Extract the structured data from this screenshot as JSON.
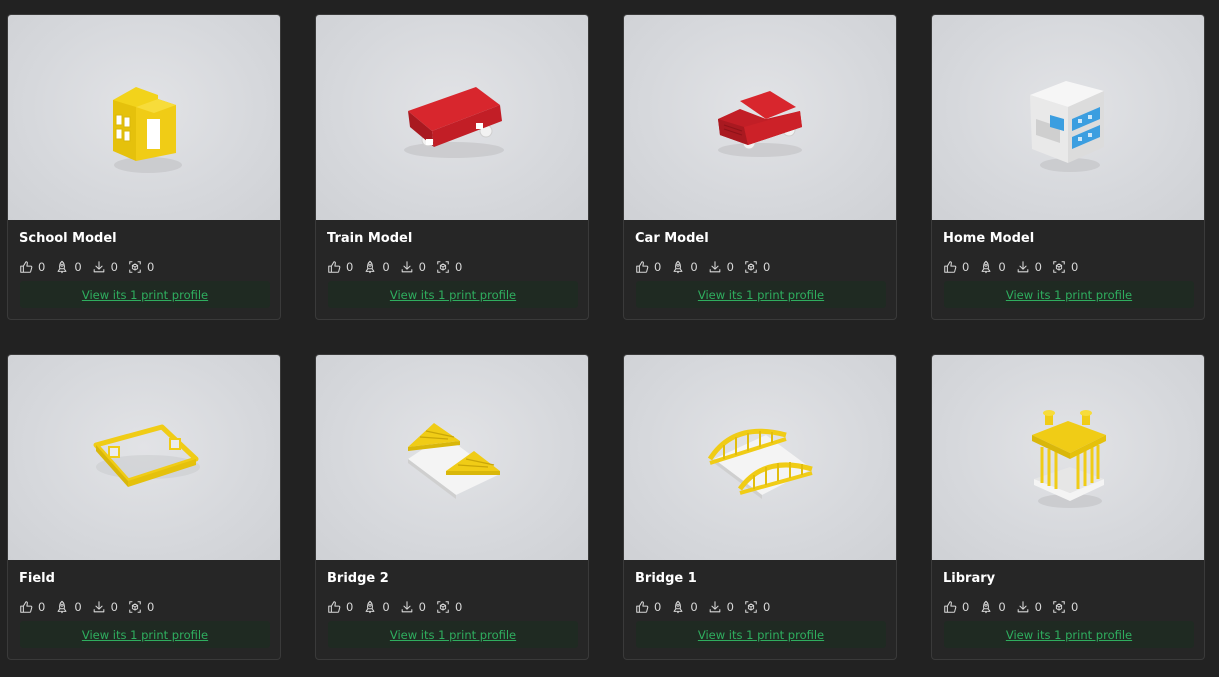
{
  "colors": {
    "page_background": "#222222",
    "card_background": "#262626",
    "link_green": "#2fae5f",
    "button_background": "#1f2a22"
  },
  "stat_icons": [
    "thumbs-up-icon",
    "rocket-icon",
    "download-icon",
    "print-icon"
  ],
  "models": [
    {
      "title": "School Model",
      "likes": "0",
      "boosts": "0",
      "downloads": "0",
      "prints": "0",
      "profile_link": "View its 1 print profile",
      "image": "yellow-school-building"
    },
    {
      "title": "Train Model",
      "likes": "0",
      "boosts": "0",
      "downloads": "0",
      "prints": "0",
      "profile_link": "View its 1 print profile",
      "image": "red-train"
    },
    {
      "title": "Car Model",
      "likes": "0",
      "boosts": "0",
      "downloads": "0",
      "prints": "0",
      "profile_link": "View its 1 print profile",
      "image": "red-car"
    },
    {
      "title": "Home Model",
      "likes": "0",
      "boosts": "0",
      "downloads": "0",
      "prints": "0",
      "profile_link": "View its 1 print profile",
      "image": "white-blue-house"
    },
    {
      "title": "Field",
      "likes": "0",
      "boosts": "0",
      "downloads": "0",
      "prints": "0",
      "profile_link": "View its 1 print profile",
      "image": "yellow-field"
    },
    {
      "title": "Bridge 2",
      "likes": "0",
      "boosts": "0",
      "downloads": "0",
      "prints": "0",
      "profile_link": "View its 1 print profile",
      "image": "yellow-triangle-bridge"
    },
    {
      "title": "Bridge 1",
      "likes": "0",
      "boosts": "0",
      "downloads": "0",
      "prints": "0",
      "profile_link": "View its 1 print profile",
      "image": "yellow-arch-bridge"
    },
    {
      "title": "Library",
      "likes": "0",
      "boosts": "0",
      "downloads": "0",
      "prints": "0",
      "profile_link": "View its 1 print profile",
      "image": "yellow-library"
    }
  ]
}
